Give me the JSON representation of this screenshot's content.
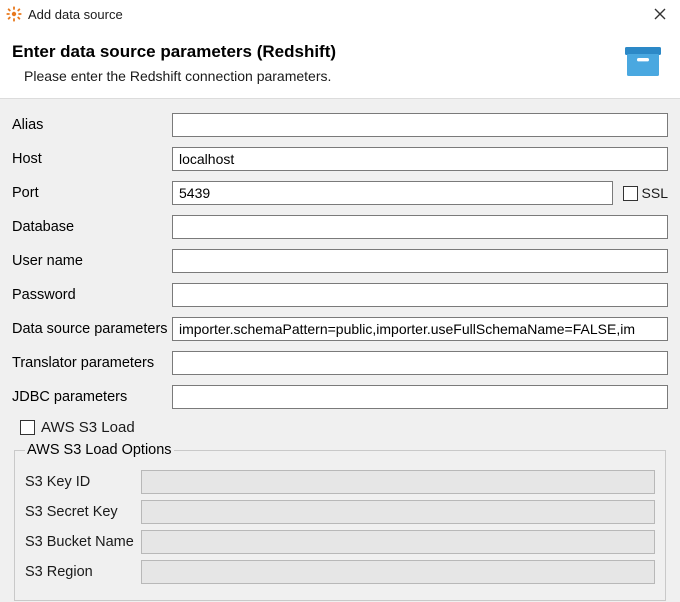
{
  "title": "Add data source",
  "header": {
    "heading": "Enter data source parameters (Redshift)",
    "subtitle": "Please enter the Redshift connection parameters."
  },
  "fields": {
    "alias": {
      "label": "Alias",
      "value": ""
    },
    "host": {
      "label": "Host",
      "value": "localhost"
    },
    "port": {
      "label": "Port",
      "value": "5439"
    },
    "ssl": {
      "label": "SSL"
    },
    "database": {
      "label": "Database",
      "value": ""
    },
    "username": {
      "label": "User name",
      "value": ""
    },
    "password": {
      "label": "Password",
      "value": ""
    },
    "dsparams": {
      "label": "Data source parameters",
      "value": "importer.schemaPattern=public,importer.useFullSchemaName=FALSE,im"
    },
    "translator": {
      "label": "Translator parameters",
      "value": ""
    },
    "jdbc": {
      "label": "JDBC parameters",
      "value": ""
    }
  },
  "s3": {
    "toggle_label": "AWS S3 Load",
    "group_label": "AWS S3 Load Options",
    "key_id": {
      "label": "S3 Key ID",
      "value": ""
    },
    "secret": {
      "label": "S3 Secret Key",
      "value": ""
    },
    "bucket": {
      "label": "S3 Bucket Name",
      "value": ""
    },
    "region": {
      "label": "S3 Region",
      "value": ""
    }
  }
}
